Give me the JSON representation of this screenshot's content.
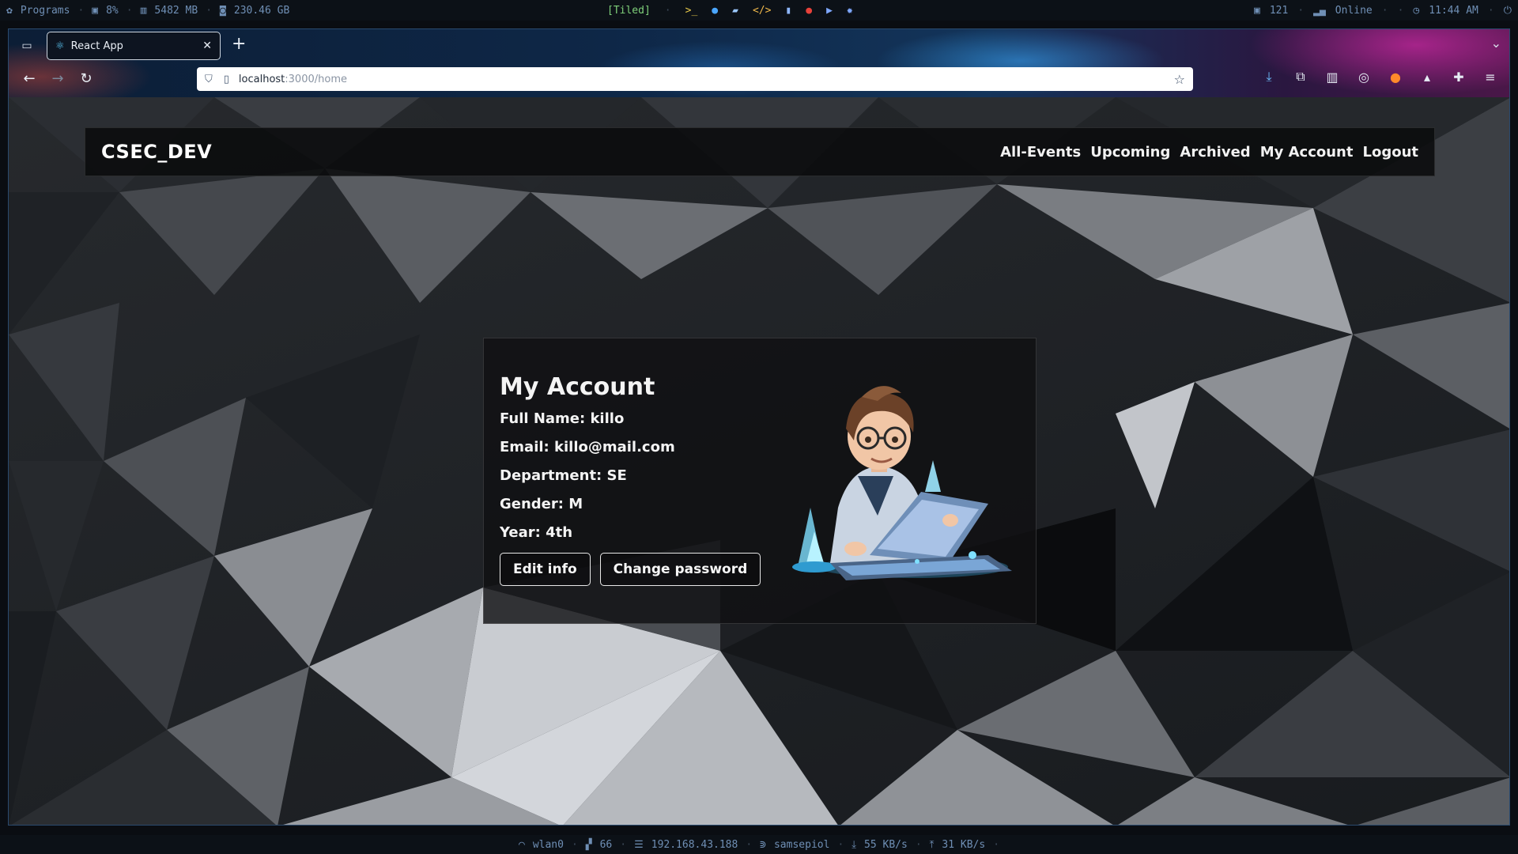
{
  "sysbar": {
    "programs": "Programs",
    "cpu": "8%",
    "mem": "5482 MB",
    "disk": "230.46 GB",
    "layout": "[Tiled]",
    "launchers": [
      "terminal-icon",
      "firefox-icon",
      "folder-icon",
      "code-icon",
      "book-icon",
      "chat-icon",
      "video-icon",
      "settings-icon"
    ],
    "updates": "121",
    "network": "Online",
    "time": "11:44 AM"
  },
  "browser": {
    "tab_title": "React App",
    "url_host": "localhost",
    "url_path": ":3000/home"
  },
  "app": {
    "brand": "CSEC_DEV",
    "nav": [
      "All-Events",
      "Upcoming",
      "Archived",
      "My Account",
      "Logout"
    ]
  },
  "account": {
    "title": "My Account",
    "full_name": "Full Name: killo",
    "email": "Email: killo@mail.com",
    "department": "Department: SE",
    "gender": "Gender: M",
    "year": "Year: 4th",
    "edit_label": "Edit info",
    "password_label": "Change password"
  },
  "bottombar": {
    "iface": "wlan0",
    "signal": "66",
    "ip": "192.168.43.188",
    "ssid": "samsepiol",
    "down": "55 KB/s",
    "up": "31 KB/s"
  },
  "colors": {
    "accent": "#6f8fb5",
    "tiled": "#7fd07a",
    "card_bg": "#101012"
  }
}
